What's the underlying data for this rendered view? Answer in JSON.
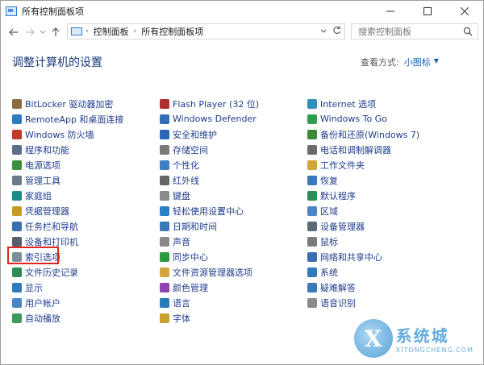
{
  "window": {
    "title": "所有控制面板项"
  },
  "nav": {
    "breadcrumb": [
      "控制面板",
      "所有控制面板项"
    ],
    "search_placeholder": "搜索控制面板"
  },
  "content": {
    "heading": "调整计算机的设置",
    "view_by_label": "查看方式:",
    "view_by_value": "小图标"
  },
  "columns": [
    [
      {
        "label": "BitLocker 驱动器加密",
        "color": "#8a6d3b"
      },
      {
        "label": "RemoteApp 和桌面连接",
        "color": "#2f7bbf"
      },
      {
        "label": "Windows 防火墙",
        "color": "#c0392b"
      },
      {
        "label": "程序和功能",
        "color": "#5a6f8a"
      },
      {
        "label": "电源选项",
        "color": "#3c8f3c"
      },
      {
        "label": "管理工具",
        "color": "#6c7a89"
      },
      {
        "label": "家庭组",
        "color": "#1f8a8a"
      },
      {
        "label": "凭据管理器",
        "color": "#c89a2a"
      },
      {
        "label": "任务栏和导航",
        "color": "#3a6fb0"
      },
      {
        "label": "设备和打印机",
        "color": "#55606e"
      },
      {
        "label": "索引选项",
        "color": "#7f8c9a"
      },
      {
        "label": "文件历史记录",
        "color": "#2e8b57"
      },
      {
        "label": "显示",
        "color": "#2f7bbf"
      },
      {
        "label": "用户帐户",
        "color": "#4a86c5"
      },
      {
        "label": "自动播放",
        "color": "#3c9a5a"
      }
    ],
    [
      {
        "label": "Flash Player (32 位)",
        "color": "#b0302a"
      },
      {
        "label": "Windows Defender",
        "color": "#2f6db5"
      },
      {
        "label": "安全和维护",
        "color": "#2a66b8"
      },
      {
        "label": "存储空间",
        "color": "#7a7a7a"
      },
      {
        "label": "个性化",
        "color": "#3f7fc4"
      },
      {
        "label": "红外线",
        "color": "#666666"
      },
      {
        "label": "键盘",
        "color": "#8a8a8a"
      },
      {
        "label": "轻松使用设置中心",
        "color": "#2b7fc6"
      },
      {
        "label": "日期和时间",
        "color": "#3a7ab8"
      },
      {
        "label": "声音",
        "color": "#8a8a8a"
      },
      {
        "label": "同步中心",
        "color": "#2e9a3e"
      },
      {
        "label": "文件资源管理器选项",
        "color": "#d4a53a"
      },
      {
        "label": "颜色管理",
        "color": "#8e44ad"
      },
      {
        "label": "语言",
        "color": "#2a7ab8"
      },
      {
        "label": "字体",
        "color": "#c9a030"
      }
    ],
    [
      {
        "label": "Internet 选项",
        "color": "#2f8fbf"
      },
      {
        "label": "Windows To Go",
        "color": "#2f9f4f"
      },
      {
        "label": "备份和还原(Windows 7)",
        "color": "#3a8a3a"
      },
      {
        "label": "电话和调制解调器",
        "color": "#6a6a6a"
      },
      {
        "label": "工作文件夹",
        "color": "#d4a53a"
      },
      {
        "label": "恢复",
        "color": "#3a7ab8"
      },
      {
        "label": "默认程序",
        "color": "#2e8b57"
      },
      {
        "label": "区域",
        "color": "#4a86c5"
      },
      {
        "label": "设备管理器",
        "color": "#5a6a7a"
      },
      {
        "label": "鼠标",
        "color": "#7a7a7a"
      },
      {
        "label": "网络和共享中心",
        "color": "#3a6fb0"
      },
      {
        "label": "系统",
        "color": "#2f7bbf"
      },
      {
        "label": "疑难解答",
        "color": "#3a7ab8"
      },
      {
        "label": "语音识别",
        "color": "#8a8a8a"
      }
    ]
  ],
  "watermark": {
    "cn": "系统城",
    "en": "XITONGCHENG.COM"
  }
}
